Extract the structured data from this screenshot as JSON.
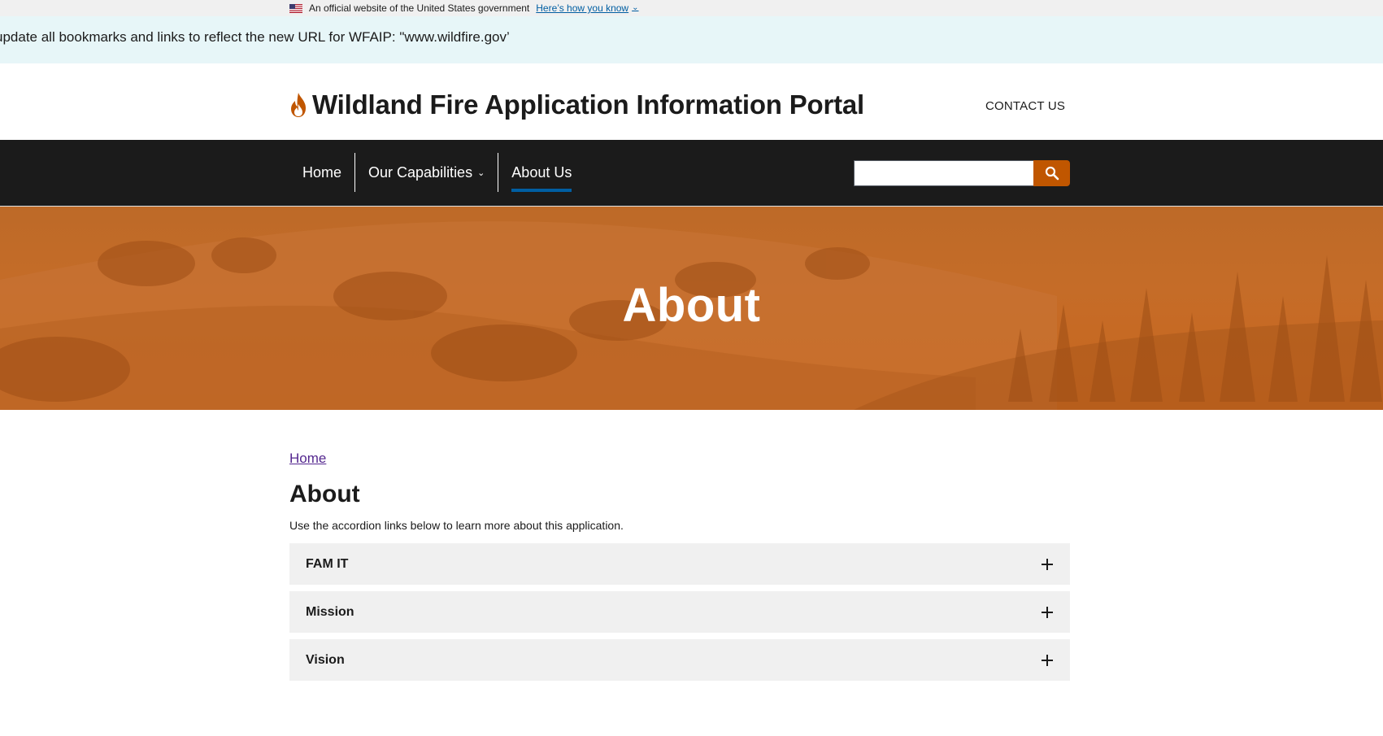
{
  "gov_banner": {
    "text": "An official website of the United States government",
    "link": "Here’s how you know"
  },
  "alert": {
    "text": "update all bookmarks and links to reflect the new URL for WFAIP: \"www.wildfire.gov’"
  },
  "header": {
    "title": "Wildland Fire Application Information Portal",
    "contact": "CONTACT US"
  },
  "nav": {
    "items": [
      {
        "label": "Home"
      },
      {
        "label": "Our Capabilities"
      },
      {
        "label": "About Us"
      }
    ],
    "active": "About Us"
  },
  "hero": {
    "title": "About"
  },
  "main": {
    "breadcrumb": "Home",
    "title": "About",
    "intro": "Use the accordion links below to learn more about this application.",
    "accordion": [
      {
        "label": "FAM IT"
      },
      {
        "label": "Mission"
      },
      {
        "label": "Vision"
      }
    ]
  },
  "colors": {
    "accent": "#c05600",
    "nav_bg": "#1b1b1b",
    "link": "#005ea2",
    "alert_bg": "#e7f6f8",
    "accordion_bg": "#f0f0f0"
  }
}
